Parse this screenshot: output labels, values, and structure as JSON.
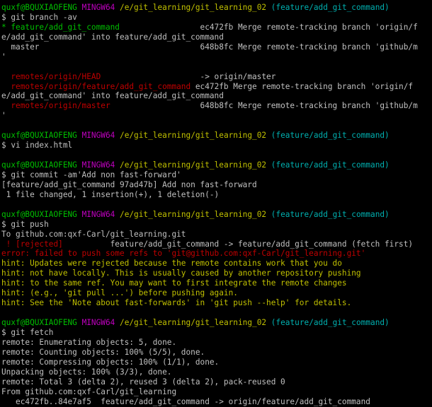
{
  "terminal": {
    "colors": {
      "background": "#000000",
      "foreground": "#c0c0c0",
      "prompt_user": "#00c000",
      "prompt_host": "#c000c0",
      "prompt_path": "#c0c000",
      "prompt_branch": "#00b0b0",
      "error": "#c00000",
      "hint": "#c0c000"
    },
    "lines": [
      {
        "segments": [
          {
            "text": "quxf@BQUXIAOFENG",
            "color": "g"
          },
          {
            "text": " "
          },
          {
            "text": "MINGW64",
            "color": "m"
          },
          {
            "text": " "
          },
          {
            "text": "/e/git_learning/git_learning_02",
            "color": "y"
          },
          {
            "text": " "
          },
          {
            "text": "(feature/add_git_command)",
            "color": "c"
          }
        ]
      },
      {
        "segments": [
          {
            "text": "$ git branch -av"
          }
        ]
      },
      {
        "segments": [
          {
            "text": "* feature/add_git_command",
            "color": "g"
          },
          {
            "text": "                 ec472fb Merge remote-tracking branch 'origin/f"
          }
        ]
      },
      {
        "segments": [
          {
            "text": "e/add_git_command' into feature/add_git_command"
          }
        ]
      },
      {
        "segments": [
          {
            "text": "  master                                  648b8fc Merge remote-tracking branch 'github/m"
          }
        ]
      },
      {
        "segments": [
          {
            "text": "'"
          }
        ]
      },
      {
        "segments": [
          {
            "text": ""
          }
        ]
      },
      {
        "segments": [
          {
            "text": "  "
          },
          {
            "text": "remotes/origin/HEAD",
            "color": "r"
          },
          {
            "text": "                     -> origin/master"
          }
        ]
      },
      {
        "segments": [
          {
            "text": "  "
          },
          {
            "text": "remotes/origin/feature/add_git_command",
            "color": "r"
          },
          {
            "text": " ec472fb Merge remote-tracking branch 'origin/f"
          }
        ]
      },
      {
        "segments": [
          {
            "text": "e/add_git_command' into feature/add_git_command"
          }
        ]
      },
      {
        "segments": [
          {
            "text": "  "
          },
          {
            "text": "remotes/origin/master",
            "color": "r"
          },
          {
            "text": "                   648b8fc Merge remote-tracking branch 'github/m"
          }
        ]
      },
      {
        "segments": [
          {
            "text": "'"
          }
        ]
      },
      {
        "segments": [
          {
            "text": ""
          }
        ]
      },
      {
        "segments": [
          {
            "text": "quxf@BQUXIAOFENG",
            "color": "g"
          },
          {
            "text": " "
          },
          {
            "text": "MINGW64",
            "color": "m"
          },
          {
            "text": " "
          },
          {
            "text": "/e/git_learning/git_learning_02",
            "color": "y"
          },
          {
            "text": " "
          },
          {
            "text": "(feature/add_git_command)",
            "color": "c"
          }
        ]
      },
      {
        "segments": [
          {
            "text": "$ vi index.html"
          }
        ]
      },
      {
        "segments": [
          {
            "text": ""
          }
        ]
      },
      {
        "segments": [
          {
            "text": "quxf@BQUXIAOFENG",
            "color": "g"
          },
          {
            "text": " "
          },
          {
            "text": "MINGW64",
            "color": "m"
          },
          {
            "text": " "
          },
          {
            "text": "/e/git_learning/git_learning_02",
            "color": "y"
          },
          {
            "text": " "
          },
          {
            "text": "(feature/add_git_command)",
            "color": "c"
          }
        ]
      },
      {
        "segments": [
          {
            "text": "$ git commit -am'Add non fast-forward'"
          }
        ]
      },
      {
        "segments": [
          {
            "text": "[feature/add_git_command 97ad47b] Add non fast-forward"
          }
        ]
      },
      {
        "segments": [
          {
            "text": " 1 file changed, 1 insertion(+), 1 deletion(-)"
          }
        ]
      },
      {
        "segments": [
          {
            "text": ""
          }
        ]
      },
      {
        "segments": [
          {
            "text": "quxf@BQUXIAOFENG",
            "color": "g"
          },
          {
            "text": " "
          },
          {
            "text": "MINGW64",
            "color": "m"
          },
          {
            "text": " "
          },
          {
            "text": "/e/git_learning/git_learning_02",
            "color": "y"
          },
          {
            "text": " "
          },
          {
            "text": "(feature/add_git_command)",
            "color": "c"
          }
        ]
      },
      {
        "segments": [
          {
            "text": "$ git push"
          }
        ]
      },
      {
        "segments": [
          {
            "text": "To github.com:qxf-Carl/git_learning.git"
          }
        ]
      },
      {
        "segments": [
          {
            "text": " ! [rejected]",
            "color": "r"
          },
          {
            "text": "          feature/add_git_command -> feature/add_git_command (fetch first)"
          }
        ]
      },
      {
        "segments": [
          {
            "text": "error: failed to push some refs to 'git@github.com:qxf-Carl/git_learning.git'",
            "color": "r"
          }
        ]
      },
      {
        "segments": [
          {
            "text": "hint: Updates were rejected because the remote contains work that you do",
            "color": "y"
          }
        ]
      },
      {
        "segments": [
          {
            "text": "hint: not have locally. This is usually caused by another repository pushing",
            "color": "y"
          }
        ]
      },
      {
        "segments": [
          {
            "text": "hint: to the same ref. You may want to first integrate the remote changes",
            "color": "y"
          }
        ]
      },
      {
        "segments": [
          {
            "text": "hint: (e.g., 'git pull ...') before pushing again.",
            "color": "y"
          }
        ]
      },
      {
        "segments": [
          {
            "text": "hint: See the 'Note about fast-forwards' in 'git push --help' for details.",
            "color": "y"
          }
        ]
      },
      {
        "segments": [
          {
            "text": ""
          }
        ]
      },
      {
        "segments": [
          {
            "text": "quxf@BQUXIAOFENG",
            "color": "g"
          },
          {
            "text": " "
          },
          {
            "text": "MINGW64",
            "color": "m"
          },
          {
            "text": " "
          },
          {
            "text": "/e/git_learning/git_learning_02",
            "color": "y"
          },
          {
            "text": " "
          },
          {
            "text": "(feature/add_git_command)",
            "color": "c"
          }
        ]
      },
      {
        "segments": [
          {
            "text": "$ git fetch"
          }
        ]
      },
      {
        "segments": [
          {
            "text": "remote: Enumerating objects: 5, done."
          }
        ]
      },
      {
        "segments": [
          {
            "text": "remote: Counting objects: 100% (5/5), done."
          }
        ]
      },
      {
        "segments": [
          {
            "text": "remote: Compressing objects: 100% (1/1), done."
          }
        ]
      },
      {
        "segments": [
          {
            "text": "Unpacking objects: 100% (3/3), done."
          }
        ]
      },
      {
        "segments": [
          {
            "text": "remote: Total 3 (delta 2), reused 3 (delta 2), pack-reused 0"
          }
        ]
      },
      {
        "segments": [
          {
            "text": "From github.com:qxf-Carl/git_learning"
          }
        ]
      },
      {
        "segments": [
          {
            "text": "   ec472fb..84e7af5  feature/add_git_command -> origin/feature/add_git_command"
          }
        ]
      }
    ]
  }
}
